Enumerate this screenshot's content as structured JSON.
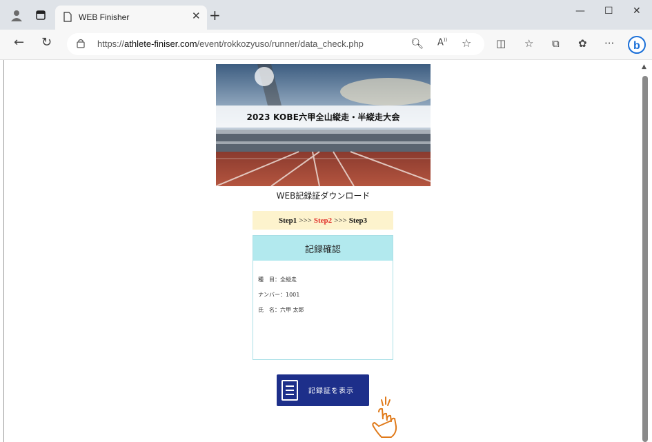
{
  "browser": {
    "tab_title": "WEB Finisher",
    "url_prefix": "https://",
    "url_host": "athlete-finiser.com",
    "url_path": "/event/rokkozyuso/runner/data_check.php",
    "accent_color": "#0a66c2"
  },
  "page": {
    "banner_title": "2023 KOBE六甲全山縦走・半縦走大会",
    "subtitle": "WEB記録証ダウンロード",
    "steps": {
      "step1": "Step1",
      "step2": "Step2",
      "step3": "Step3",
      "separator": ">>>",
      "current_color": "#e0302a"
    },
    "record_card": {
      "heading": "記録確認",
      "lines": [
        "種　目：全縦走",
        "ナンバー：1001",
        "氏　名：六甲 太郎"
      ]
    },
    "download_button": {
      "label": "記録証を表示",
      "color": "#1d2f8a"
    }
  }
}
